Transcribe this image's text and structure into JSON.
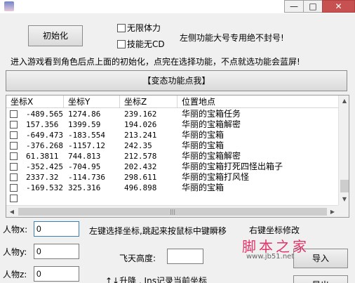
{
  "window": {
    "minimize": "—",
    "maximize": "□",
    "close": "✕"
  },
  "controls": {
    "init_button": "初始化",
    "unlimited_stamina": "无限体力",
    "skill_no_cd": "技能无CD",
    "note_right": "左侧功能大号专用绝不封号!",
    "instruction": "进入游戏看到角色后点上面的初始化，点完在选择功能，不点就选功能会蓝屏!",
    "transform_button": "【变态功能点我】"
  },
  "list": {
    "columns": [
      "坐标X",
      "坐标Y",
      "坐标Z",
      "位置地点"
    ],
    "rows": [
      [
        "-489.565",
        "1274.86",
        "239.162",
        "华丽的宝箱任务"
      ],
      [
        "157.356",
        "1399.59",
        "194.026",
        "华丽的宝箱解密"
      ],
      [
        "-649.473",
        "-183.554",
        "213.241",
        "华丽的宝箱"
      ],
      [
        "-376.268",
        "-1157.12",
        "242.35",
        "华丽的宝箱"
      ],
      [
        "61.3811",
        "744.813",
        "212.578",
        "华丽的宝箱解密"
      ],
      [
        "-352.425",
        "-704.95",
        "202.432",
        "华丽的宝箱打死四怪出箱子"
      ],
      [
        "2337.32",
        "-114.736",
        "298.611",
        "华丽的宝箱打风怪"
      ],
      [
        "-169.532",
        "325.316",
        "496.898",
        "华丽的宝箱"
      ],
      [
        "",
        "",
        "",
        ""
      ]
    ]
  },
  "bottom": {
    "label_x": "人物x:",
    "value_x": "0",
    "label_y": "人物y:",
    "value_y": "0",
    "label_z": "人物z:",
    "value_z": "0",
    "hint_select": "左键选择坐标,跳起来按鼠标中键瞬移",
    "hint_edit": "右键坐标修改",
    "fly_label": "飞天高度:",
    "fly_value": "",
    "hint_keys": "↑↓升降 , Ins记录当前坐标",
    "import_button": "导入",
    "export_button": "导出"
  },
  "watermark": {
    "main": "脚本之家",
    "sub": "www.jb51.net"
  }
}
